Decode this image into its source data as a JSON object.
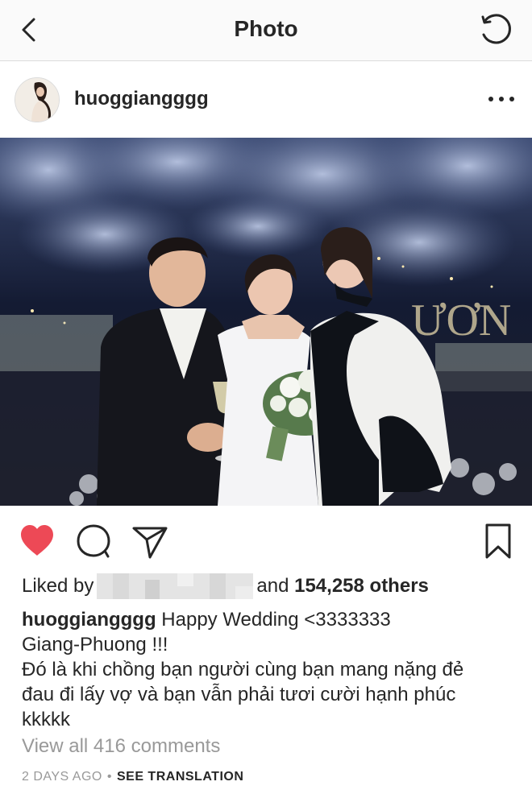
{
  "nav": {
    "title": "Photo",
    "back_icon": "chevron-left-icon",
    "refresh_icon": "refresh-icon"
  },
  "post": {
    "username": "huoggiangggg",
    "more_icon": "more-horizontal-icon"
  },
  "actions": {
    "liked": true,
    "like_color": "#ed4956",
    "icons": [
      "heart-icon",
      "comment-icon",
      "share-icon",
      "bookmark-icon"
    ]
  },
  "likes": {
    "prefix": "Liked by",
    "suffix_word": "and",
    "count_text": "154,258 others"
  },
  "caption": {
    "username": "huoggiangggg",
    "text": " Happy Wedding <3333333",
    "lines": [
      "Giang-Phuong !!!",
      "Đó là khi chồng bạn người cùng bạn mang nặng đẻ",
      "đau đi lấy vợ và bạn vẫn phải tươi cười hạnh phúc",
      "kkkkk"
    ]
  },
  "comments_link": "View all 416 comments",
  "meta": {
    "timestamp": "2 DAYS AGO",
    "separator": "•",
    "translation": "SEE TRANSLATION"
  }
}
